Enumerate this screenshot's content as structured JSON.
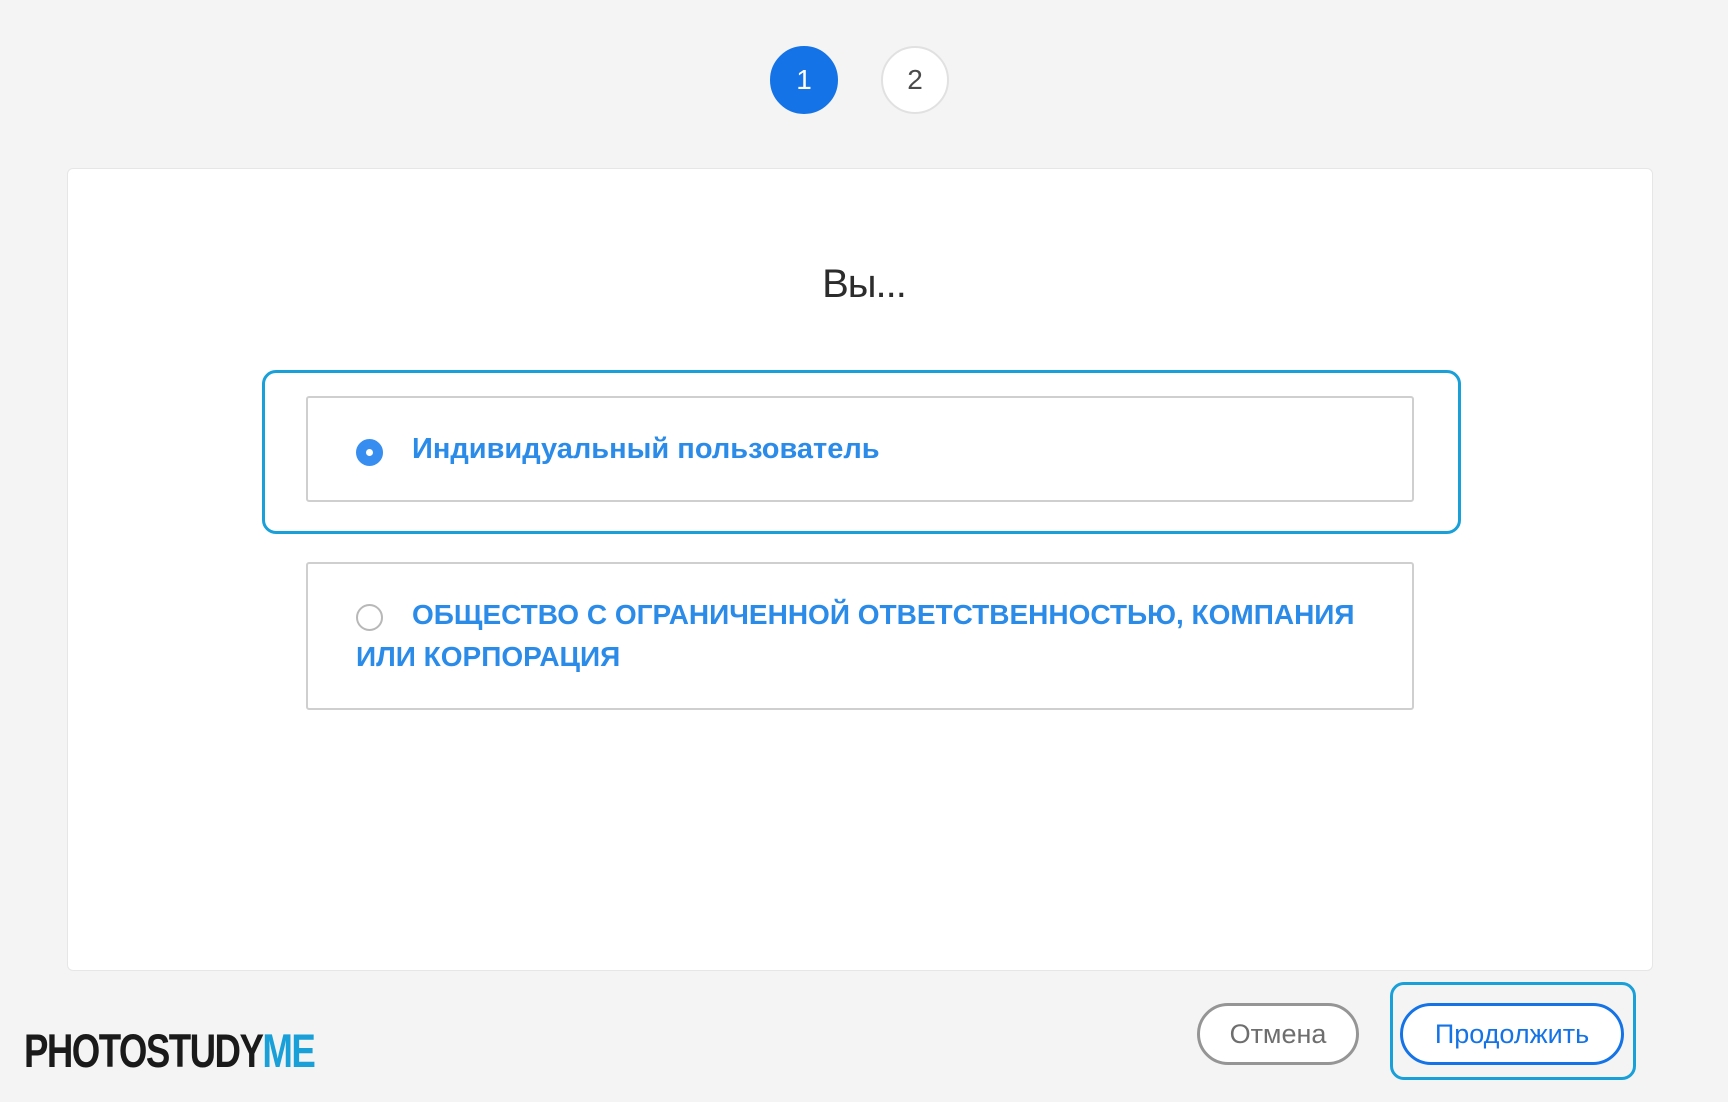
{
  "stepper": {
    "steps": [
      {
        "label": "1",
        "active": true
      },
      {
        "label": "2",
        "active": false
      }
    ]
  },
  "question": {
    "title": "Вы..."
  },
  "options": [
    {
      "label": "Индивидуальный пользователь",
      "selected": true
    },
    {
      "label": "ОБЩЕСТВО С ОГРАНИЧЕННОЙ ОТВЕТСТВЕННОСТЬЮ, КОМПАНИЯ ИЛИ КОРПОРАЦИЯ",
      "selected": false
    }
  ],
  "footer": {
    "cancel_label": "Отмена",
    "continue_label": "Продолжить"
  },
  "watermark": {
    "part1": "PHOTOSTUDY",
    "part2": "ME"
  },
  "colors": {
    "accent": "#1473e6",
    "focus_ring": "#1aa0d8",
    "option_text": "#2b8be8",
    "background": "#f4f4f4"
  }
}
